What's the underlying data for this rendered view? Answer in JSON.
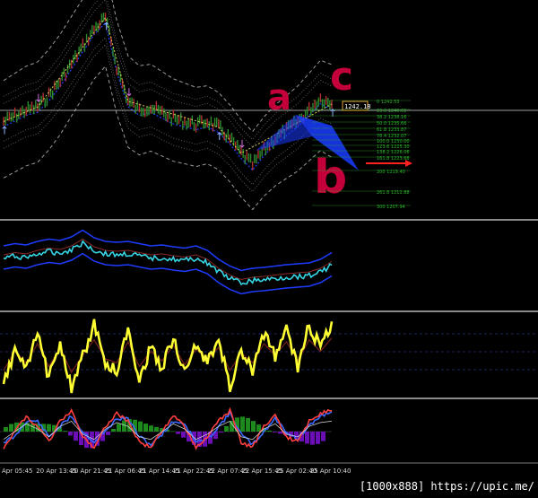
{
  "watermark": "[1000x888] https://upic.me/",
  "colors": {
    "background": "#000000",
    "price_bars": "#2e8b2e",
    "zigzag": "#d7d15a",
    "channel": "#dcdcdc",
    "blue_line": "#1e3cff",
    "annotation_red": "#c4003a",
    "fib_green": "#2bb32b",
    "current_price_box": "#e8a23a",
    "panel_separator": "#8a8a8a",
    "osc_yellow": "#ffff33",
    "osc_cyan": "#36d6e6",
    "stoch_red": "#ff4040",
    "stoch_blue": "#3a6bff",
    "hist_purple": "#6a0fb5",
    "hist_green": "#1e8a1e"
  },
  "annotations": [
    {
      "kind": "letter",
      "text": "c",
      "location": "upper-right"
    },
    {
      "kind": "letter",
      "text": "a",
      "location": "middle"
    },
    {
      "kind": "letter",
      "text": "b",
      "location": "lower-middle"
    }
  ],
  "current_price_label": "1242.18",
  "fib_levels": [
    {
      "label": "0 1242.53"
    },
    {
      "label": "23.6 1240.61"
    },
    {
      "label": "38.2 1238.16"
    },
    {
      "label": "50.0 1235.66"
    },
    {
      "label": "61.8 1233.87"
    },
    {
      "label": "76.4 1232.07"
    },
    {
      "label": "100.0 1230.00"
    },
    {
      "label": "123.6 1225.30"
    },
    {
      "label": "138.2 1226.06"
    },
    {
      "label": "161.8 1223.68"
    },
    {
      "label": "200 1219.40"
    },
    {
      "label": "261.8 1212.88"
    },
    {
      "label": "300 1207.94"
    }
  ],
  "chart_data": [
    {
      "type": "line",
      "panel": "price",
      "series": [
        {
          "values": [
            1236,
            1238,
            1240,
            1241,
            1245,
            1250,
            1256,
            1262,
            1268,
            1272,
            1255,
            1243,
            1240,
            1241,
            1239,
            1237,
            1236,
            1235,
            1236,
            1234,
            1230,
            1225,
            1221,
            1226,
            1230,
            1233,
            1236,
            1240,
            1244,
            1242
          ]
        }
      ]
    },
    {
      "type": "line",
      "panel": "oscillator-1",
      "series": [
        {
          "values": [
            0.2,
            0.25,
            0.22,
            0.3,
            0.35,
            0.32,
            0.4,
            0.55,
            0.38,
            0.3,
            0.28,
            0.3,
            0.25,
            0.2,
            0.22,
            0.18,
            0.15,
            0.2,
            0.1,
            -0.1,
            -0.25,
            -0.35,
            -0.3,
            -0.28,
            -0.25,
            -0.22,
            -0.2,
            -0.18,
            -0.1,
            0.05
          ]
        }
      ]
    },
    {
      "type": "line",
      "panel": "oscillator-2",
      "series": [
        {
          "values": [
            10,
            60,
            30,
            80,
            20,
            70,
            5,
            50,
            90,
            40,
            30,
            85,
            20,
            60,
            35,
            75,
            25,
            65,
            40,
            70,
            10,
            55,
            30,
            80,
            50,
            85,
            35,
            90,
            60,
            95
          ]
        }
      ]
    },
    {
      "type": "line",
      "panel": "stochastic",
      "series": [
        {
          "values": [
            20,
            50,
            80,
            60,
            30,
            70,
            90,
            40,
            20,
            60,
            85,
            70,
            30,
            20,
            50,
            80,
            60,
            20,
            40,
            70,
            90,
            30,
            20,
            60,
            80,
            40,
            30,
            70,
            85,
            90
          ]
        },
        {
          "values": [
            30,
            40,
            70,
            70,
            40,
            60,
            80,
            50,
            30,
            50,
            75,
            75,
            40,
            25,
            45,
            70,
            65,
            30,
            35,
            60,
            85,
            45,
            25,
            50,
            75,
            50,
            35,
            60,
            80,
            88
          ]
        }
      ]
    }
  ],
  "x_axis_ticks": [
    "Apr 05:45",
    "20 Apr 13:45",
    "20 Apr 21:45",
    "21 Apr 06:45",
    "21 Apr 14:45",
    "21 Apr 22:45",
    "22 Apr 07:45",
    "22 Apr 15:45",
    "25 Apr 02:40",
    "25 Apr 10:40"
  ]
}
